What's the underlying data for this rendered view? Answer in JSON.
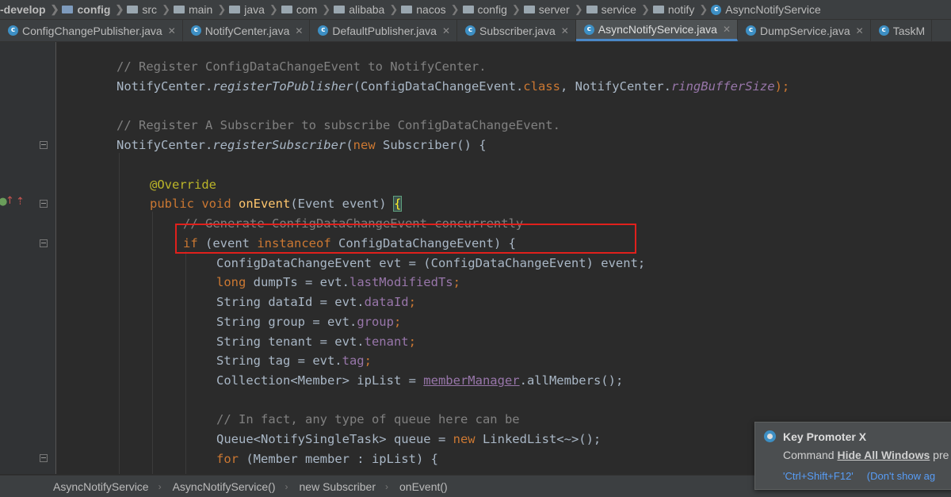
{
  "navbar": {
    "items": [
      {
        "label": "-develop",
        "icon": "none"
      },
      {
        "label": "config",
        "icon": "module-folder-icon"
      },
      {
        "label": "src",
        "icon": "folder-icon"
      },
      {
        "label": "main",
        "icon": "folder-icon"
      },
      {
        "label": "java",
        "icon": "folder-icon"
      },
      {
        "label": "com",
        "icon": "folder-icon"
      },
      {
        "label": "alibaba",
        "icon": "folder-icon"
      },
      {
        "label": "nacos",
        "icon": "folder-icon"
      },
      {
        "label": "config",
        "icon": "folder-icon"
      },
      {
        "label": "server",
        "icon": "folder-icon"
      },
      {
        "label": "service",
        "icon": "folder-icon"
      },
      {
        "label": "notify",
        "icon": "folder-icon"
      },
      {
        "label": "AsyncNotifyService",
        "icon": "class-icon"
      }
    ]
  },
  "tabs": [
    {
      "label": "ConfigChangePublisher.java",
      "active": false
    },
    {
      "label": "NotifyCenter.java",
      "active": false
    },
    {
      "label": "DefaultPublisher.java",
      "active": false
    },
    {
      "label": "Subscriber.java",
      "active": false
    },
    {
      "label": "AsyncNotifyService.java",
      "active": true
    },
    {
      "label": "DumpService.java",
      "active": false
    },
    {
      "label": "TaskM",
      "active": false
    }
  ],
  "code": {
    "l1": "// Register ConfigDataChangeEvent to NotifyCenter.",
    "l2_a": "NotifyCenter.",
    "l2_b": "registerToPublisher",
    "l2_c": "(ConfigDataChangeEvent.",
    "l2_d": "class",
    "l2_e": ", NotifyCenter.",
    "l2_f": "ringBufferSize",
    "l2_g": ");",
    "l4": "// Register A Subscriber to subscribe ConfigDataChangeEvent.",
    "l5_a": "NotifyCenter.",
    "l5_b": "registerSubscriber",
    "l5_c": "(",
    "l5_d": "new",
    "l5_e": " Subscriber() {",
    "l7": "@Override",
    "l8_a": "public void ",
    "l8_b": "onEvent",
    "l8_c": "(Event event) ",
    "l8_d": "{",
    "l9": "// Generate ConfigDataChangeEvent concurrently",
    "l10_a": "if",
    "l10_b": " (event ",
    "l10_c": "instanceof",
    "l10_d": " ConfigDataChangeEvent) {",
    "l11_a": "ConfigDataChangeEvent evt = (ConfigDataChangeEvent) event;",
    "l12_a": "long",
    "l12_b": " dumpTs = evt.",
    "l12_c": "lastModifiedTs",
    "l12_d": ";",
    "l13_a": "String dataId = evt.",
    "l13_b": "dataId",
    "l13_c": ";",
    "l14_a": "String group = evt.",
    "l14_b": "group",
    "l14_c": ";",
    "l15_a": "String tenant = evt.",
    "l15_b": "tenant",
    "l15_c": ";",
    "l16_a": "String tag = evt.",
    "l16_b": "tag",
    "l16_c": ";",
    "l17_a": "Collection<Member> ipList = ",
    "l17_b": "memberManager",
    "l17_c": ".allMembers();",
    "l19": "// In fact, any type of queue here can be",
    "l20_a": "Queue<NotifySingleTask> queue = ",
    "l20_b": "new",
    "l20_c": " LinkedList<~>();",
    "l21_a": "for",
    "l21_b": " (Member member : ipList) {"
  },
  "bottom_breadcrumb": [
    "AsyncNotifyService",
    "AsyncNotifyService()",
    "new Subscriber",
    "onEvent()"
  ],
  "popup": {
    "title": "Key Promoter X",
    "body_prefix": "Command ",
    "body_command": "Hide All Windows",
    "body_suffix": " pre",
    "link_shortcut": "'Ctrl+Shift+F12'",
    "link_dismiss": "(Don't show ag"
  },
  "colors": {
    "highlight_box": "#e0201c",
    "keyword": "#cc7832",
    "comment": "#808080",
    "function": "#ffc66d",
    "field": "#9876aa"
  }
}
